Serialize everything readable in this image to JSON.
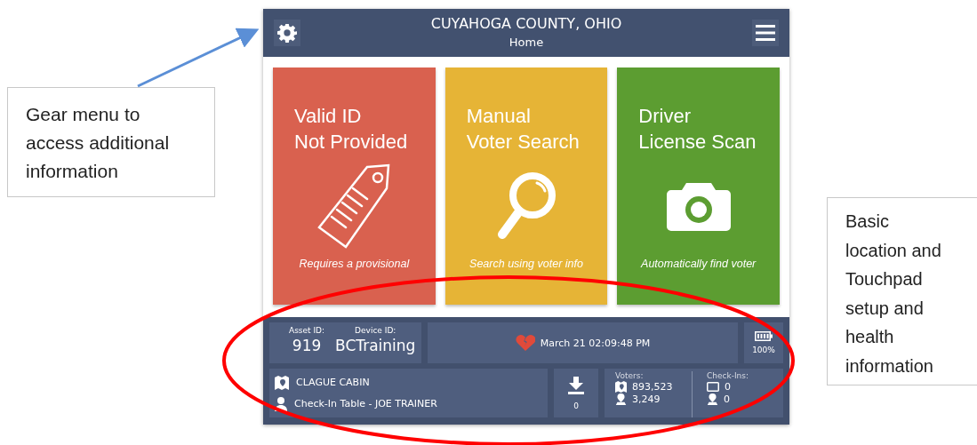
{
  "header": {
    "title": "CUYAHOGA COUNTY, OHIO",
    "subtitle": "Home"
  },
  "tiles": [
    {
      "kind": "tag",
      "title": [
        "Valid ID",
        "Not Provided"
      ],
      "caption": "Requires a provisional",
      "color": "#d9614f"
    },
    {
      "kind": "search",
      "title": [
        "Manual",
        "Voter Search"
      ],
      "caption": "Search using voter info",
      "color": "#e6b436"
    },
    {
      "kind": "camera",
      "title": [
        "Driver",
        "License Scan"
      ],
      "caption": "Automatically find voter",
      "color": "#5c9d31"
    }
  ],
  "status": {
    "asset_label": "Asset ID:",
    "asset_id": "919",
    "device_label": "Device ID:",
    "device_id": "BCTraining",
    "datetime": "March 21  02:09:48 PM",
    "battery": "100%",
    "location": "CLAGUE CABIN",
    "station": "Check-In Table - JOE TRAINER",
    "downloads": "0",
    "voters_label": "Voters:",
    "voters_total": "893,523",
    "voters_site": "3,249",
    "checkins_label": "Check-Ins:",
    "checkins_device": "0",
    "checkins_site": "0"
  },
  "annotations": [
    {
      "lines": [
        "Gear menu to",
        "access additional",
        "information"
      ]
    },
    {
      "lines": [
        "Basic",
        "location and",
        "Touchpad",
        "setup and",
        "health",
        "information"
      ]
    }
  ]
}
